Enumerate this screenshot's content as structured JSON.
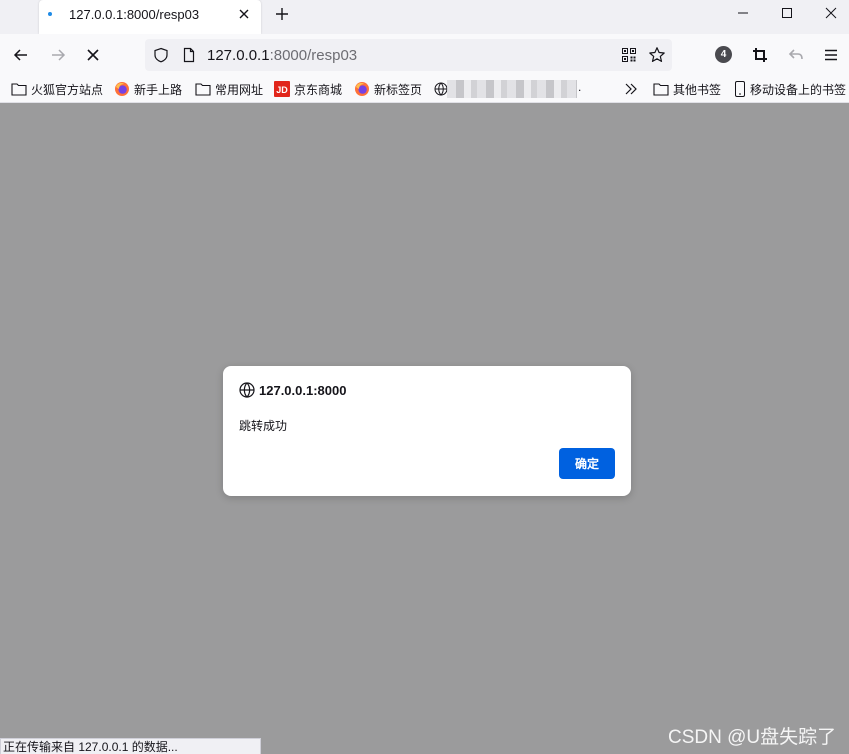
{
  "tab": {
    "title": "127.0.0.1:8000/resp03"
  },
  "urlbar": {
    "host": "127.0.0.1",
    "rest": ":8000/resp03"
  },
  "nav": {
    "extensions_badge": "4"
  },
  "bookmarks": {
    "items": [
      {
        "label": "火狐官方站点",
        "icon": "folder-icon"
      },
      {
        "label": "新手上路",
        "icon": "firefox-icon"
      },
      {
        "label": "常用网址",
        "icon": "folder-icon"
      },
      {
        "label": "京东商城",
        "icon": "jd-icon"
      },
      {
        "label": "新标签页",
        "icon": "firefox-icon"
      }
    ],
    "blurred_suffix": ".",
    "other": "其他书签",
    "mobile": "移动设备上的书签"
  },
  "dialog": {
    "origin": "127.0.0.1:8000",
    "message": "跳转成功",
    "ok_label": "确定"
  },
  "status": {
    "text": "正在传输来自 127.0.0.1 的数据..."
  },
  "watermark": "CSDN @U盘失踪了",
  "colors": {
    "accent": "#0061e0",
    "overlay": "#9b9b9c",
    "tab_dot": "#1f8be6"
  }
}
